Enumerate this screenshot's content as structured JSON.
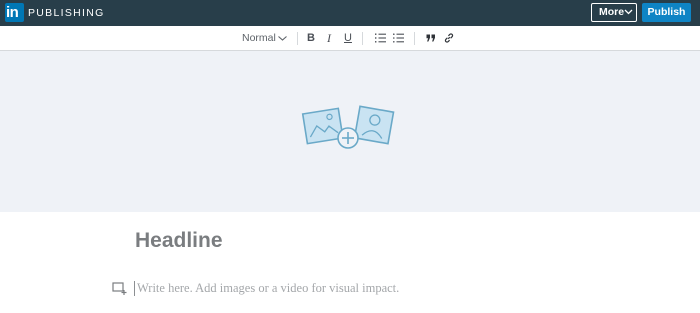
{
  "header": {
    "logo_text": "in",
    "app_title": "PUBLISHING",
    "more_label": "More",
    "publish_label": "Publish",
    "brand_color": "#0077b5",
    "bar_color": "#283e4a"
  },
  "toolbar": {
    "style_select_value": "Normal",
    "bold_label": "B",
    "italic_label": "I",
    "underline_label": "U",
    "icons": [
      "chevron-down-icon",
      "numbered-list-icon",
      "bulleted-list-icon",
      "quote-icon",
      "link-icon"
    ]
  },
  "cover": {
    "icon": "add-cover-image-icon",
    "background": "#eff2f7"
  },
  "editor": {
    "headline_placeholder": "Headline",
    "body_placeholder": "Write here. Add images or a video for visual impact."
  }
}
